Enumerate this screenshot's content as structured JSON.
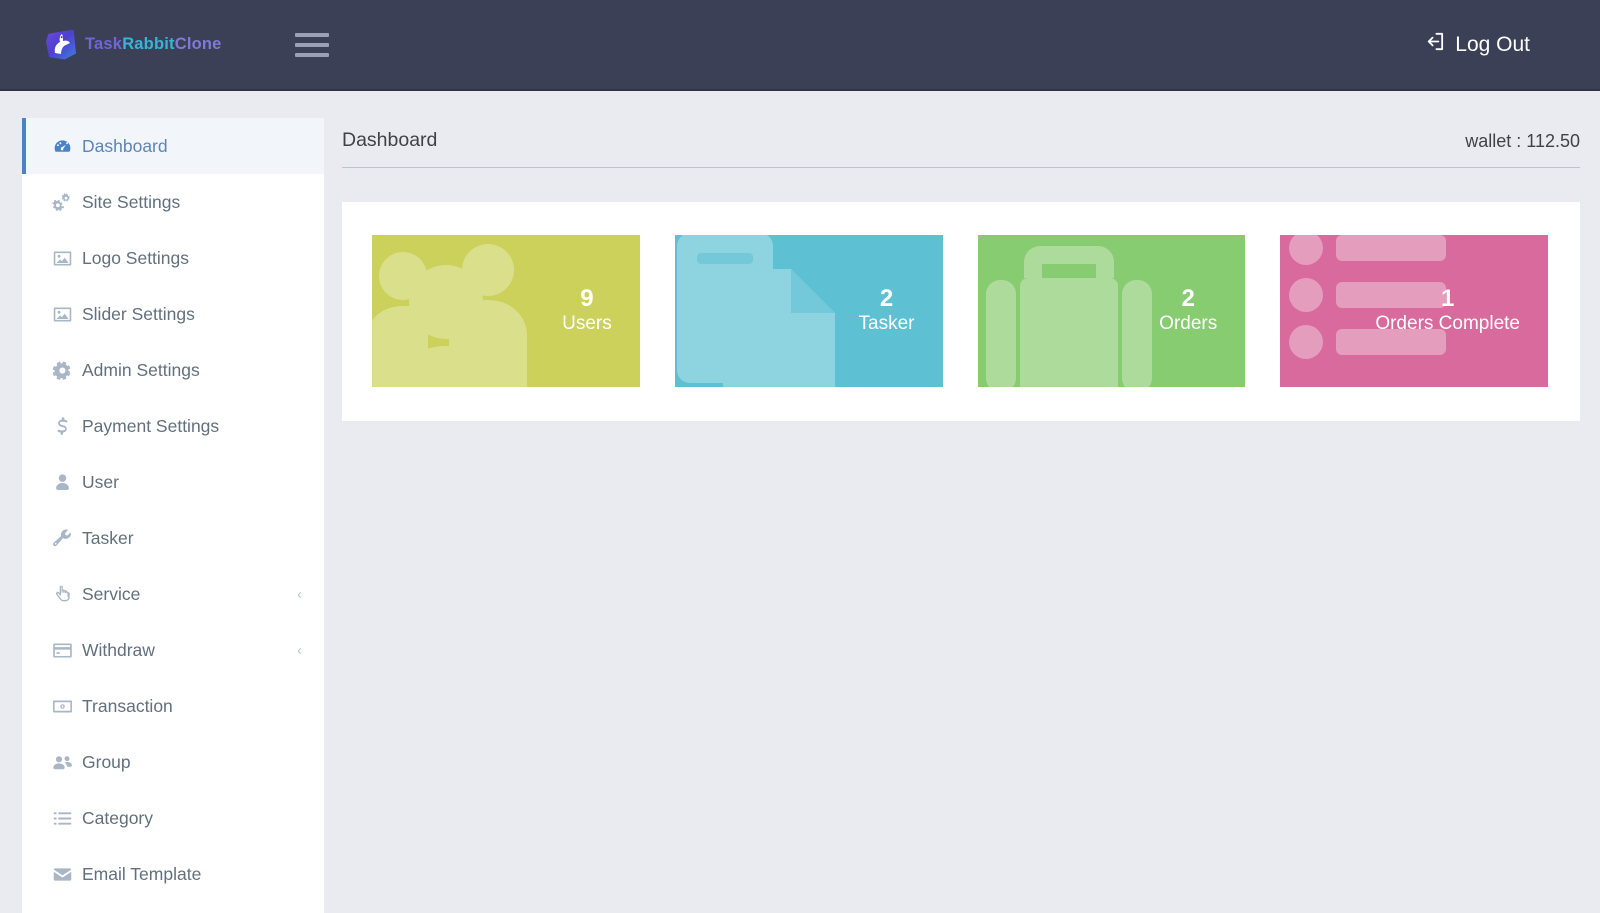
{
  "header": {
    "brand": {
      "word1": "Task",
      "word2": "Rabbit",
      "word3": "Clone",
      "icon": "rabbit-logo-icon"
    },
    "menu_toggle": "hamburger-menu-icon",
    "logout_label": "Log Out",
    "logout_icon": "sign-out-icon"
  },
  "sidebar": {
    "items": [
      {
        "label": "Dashboard",
        "icon": "tachometer-icon",
        "active": true,
        "caret": ""
      },
      {
        "label": "Site Settings",
        "icon": "cogs-icon",
        "active": false,
        "caret": ""
      },
      {
        "label": "Logo Settings",
        "icon": "image-icon",
        "active": false,
        "caret": ""
      },
      {
        "label": "Slider Settings",
        "icon": "image-icon",
        "active": false,
        "caret": ""
      },
      {
        "label": "Admin Settings",
        "icon": "cog-icon",
        "active": false,
        "caret": ""
      },
      {
        "label": "Payment Settings",
        "icon": "dollar-sign-icon",
        "active": false,
        "caret": ""
      },
      {
        "label": "User",
        "icon": "user-icon",
        "active": false,
        "caret": ""
      },
      {
        "label": "Tasker",
        "icon": "wrench-icon",
        "active": false,
        "caret": ""
      },
      {
        "label": "Service",
        "icon": "hand-pointer-icon",
        "active": false,
        "caret": "‹"
      },
      {
        "label": "Withdraw",
        "icon": "credit-card-icon",
        "active": false,
        "caret": "‹"
      },
      {
        "label": "Transaction",
        "icon": "money-bill-icon",
        "active": false,
        "caret": ""
      },
      {
        "label": "Group",
        "icon": "users-icon",
        "active": false,
        "caret": ""
      },
      {
        "label": "Category",
        "icon": "list-icon",
        "active": false,
        "caret": ""
      },
      {
        "label": "Email Template",
        "icon": "envelope-icon",
        "active": false,
        "caret": ""
      }
    ]
  },
  "main": {
    "page_title": "Dashboard",
    "wallet_text": "wallet : 112.50",
    "stats": [
      {
        "value": "9",
        "label": "Users",
        "color": "#cbd15a",
        "icon": "users-group-icon"
      },
      {
        "value": "2",
        "label": "Tasker",
        "color": "#5dc1d3",
        "icon": "copy-files-icon"
      },
      {
        "value": "2",
        "label": "Orders",
        "color": "#88cc72",
        "icon": "briefcase-icon"
      },
      {
        "value": "1",
        "label": "Orders Complete",
        "color": "#d86a9d",
        "icon": "list-ul-icon"
      }
    ]
  }
}
